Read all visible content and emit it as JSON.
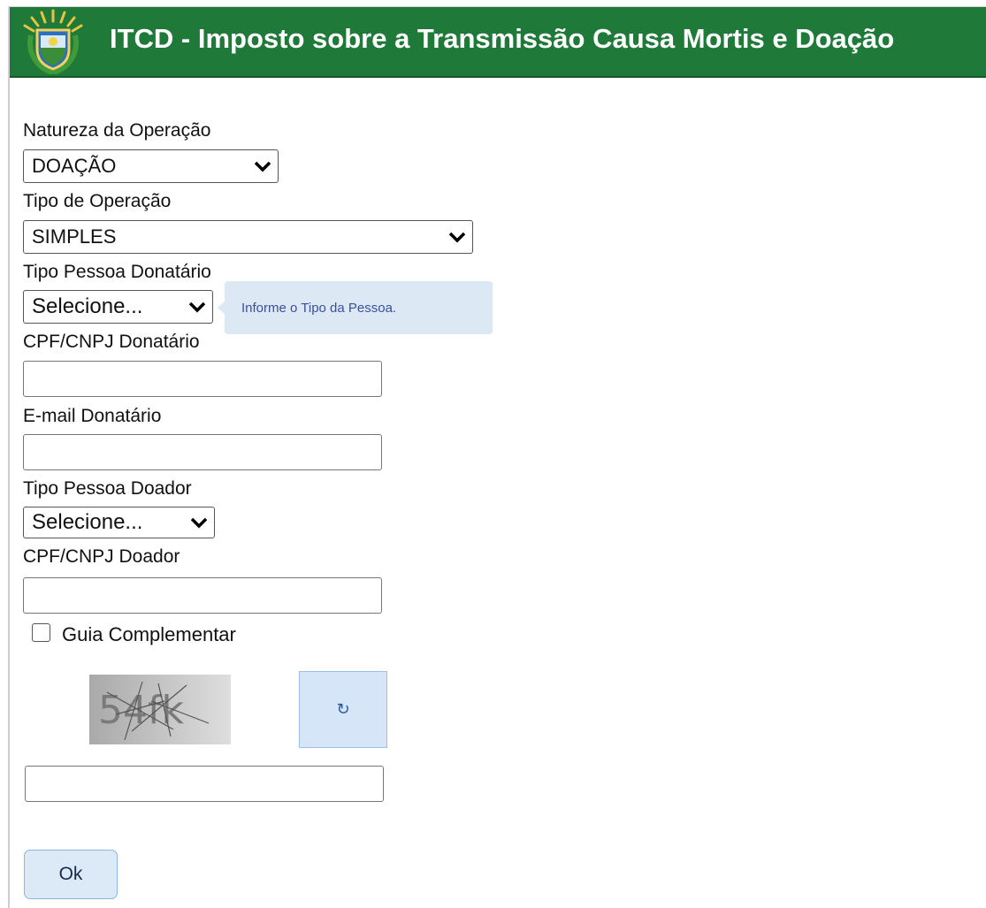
{
  "header": {
    "title": "ITCD - Imposto sobre a Transmissão Causa Mortis e Doação",
    "logo_icon": "state-coat-of-arms-icon",
    "background_color": "#1f7a3a"
  },
  "form": {
    "natureza": {
      "label": "Natureza da Operação",
      "selected": "DOAÇÃO"
    },
    "tipo_operacao": {
      "label": "Tipo de Operação",
      "selected": "SIMPLES"
    },
    "tipo_pessoa_donatario": {
      "label": "Tipo Pessoa Donatário",
      "selected": "Selecione...",
      "tooltip": "Informe o Tipo da Pessoa."
    },
    "cpf_cnpj_donatario": {
      "label": "CPF/CNPJ Donatário",
      "value": ""
    },
    "email_donatario": {
      "label": "E-mail Donatário",
      "value": ""
    },
    "tipo_pessoa_doador": {
      "label": "Tipo Pessoa Doador",
      "selected": "Selecione..."
    },
    "cpf_cnpj_doador": {
      "label": "CPF/CNPJ Doador",
      "value": ""
    },
    "guia_complementar": {
      "label": "Guia Complementar",
      "checked": false
    },
    "captcha": {
      "text": "54fk",
      "refresh_icon": "refresh-icon",
      "refresh_glyph": "↻",
      "answer_value": ""
    },
    "ok_label": "Ok"
  },
  "colors": {
    "tooltip_bg": "#dde8f5",
    "tooltip_text": "#3a4fa0",
    "button_bg": "#dce9f7"
  }
}
